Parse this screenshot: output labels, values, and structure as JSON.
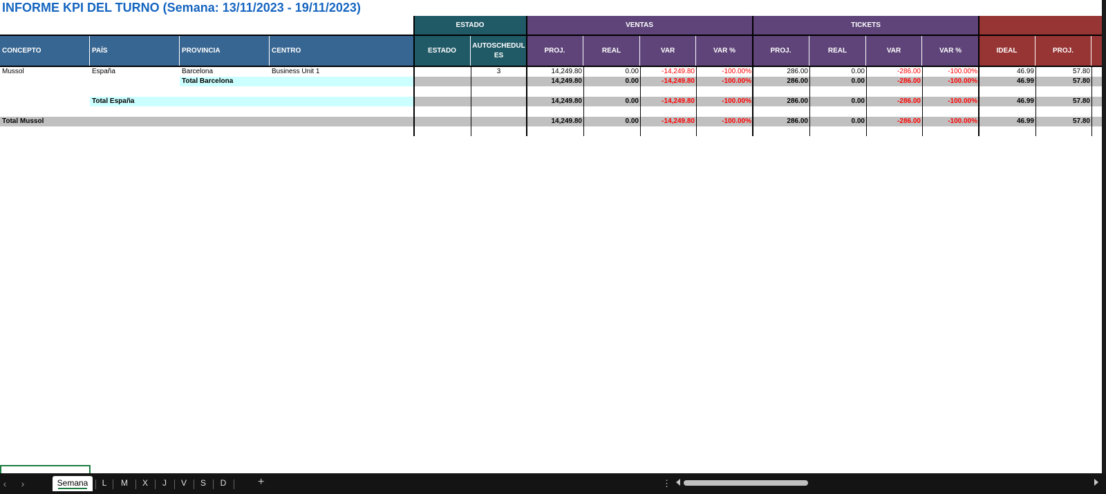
{
  "title": "INFORME KPI DEL TURNO (Semana: 13/11/2023 - 19/11/2023)",
  "groups": {
    "estado": "ESTADO",
    "ventas": "VENTAS",
    "tickets": "TICKETS"
  },
  "columns": {
    "concepto": "CONCEPTO",
    "pais": "PAÍS",
    "provincia": "PROVINCIA",
    "centro": "CENTRO",
    "estado": "ESTADO",
    "autoschedules": "AUTOSCHEDULES",
    "ventas_proj": "PROJ.",
    "ventas_real": "REAL",
    "ventas_var": "VAR",
    "ventas_varpct": "VAR %",
    "tickets_proj": "PROJ.",
    "tickets_real": "REAL",
    "tickets_var": "VAR",
    "tickets_varpct": "VAR %",
    "ideal": "IDEAL",
    "proj": "PROJ."
  },
  "rows": [
    {
      "concepto": "Mussol",
      "pais": "España",
      "provincia": "Barcelona",
      "centro": "Business Unit 1",
      "estado": "",
      "autoschedules": "3",
      "v_proj": "14,249.80",
      "v_real": "0.00",
      "v_var": "-14,249.80",
      "v_varpct": "-100.00%",
      "t_proj": "286.00",
      "t_real": "0.00",
      "t_var": "-286.00",
      "t_varpct": "-100.00%",
      "ideal": "46.99",
      "proj": "57.80"
    },
    {
      "label": "Total Barcelona",
      "v_proj": "14,249.80",
      "v_real": "0.00",
      "v_var": "-14,249.80",
      "v_varpct": "-100.00%",
      "t_proj": "286.00",
      "t_real": "0.00",
      "t_var": "-286.00",
      "t_varpct": "-100.00%",
      "ideal": "46.99",
      "proj": "57.80"
    },
    {
      "label": "Total España",
      "v_proj": "14,249.80",
      "v_real": "0.00",
      "v_var": "-14,249.80",
      "v_varpct": "-100.00%",
      "t_proj": "286.00",
      "t_real": "0.00",
      "t_var": "-286.00",
      "t_varpct": "-100.00%",
      "ideal": "46.99",
      "proj": "57.80"
    },
    {
      "label": "Total Mussol",
      "v_proj": "14,249.80",
      "v_real": "0.00",
      "v_var": "-14,249.80",
      "v_varpct": "-100.00%",
      "t_proj": "286.00",
      "t_real": "0.00",
      "t_var": "-286.00",
      "t_varpct": "-100.00%",
      "ideal": "46.99",
      "proj": "57.80"
    }
  ],
  "sheet_tabs": [
    "Semana",
    "L",
    "M",
    "X",
    "J",
    "V",
    "S",
    "D"
  ],
  "active_tab": "Semana",
  "icons": {
    "prev": "chevron-left-icon",
    "next": "chevron-right-icon",
    "add": "plus-icon",
    "more": "more-vertical-icon"
  },
  "colors": {
    "header_blue": "#386692",
    "header_teal": "#215a67",
    "header_purple": "#5e4479",
    "header_red": "#973434",
    "negative": "#ff0000",
    "total_grey": "#c0c0c0",
    "total_cyan": "#ccffff",
    "title": "#1565c0"
  }
}
